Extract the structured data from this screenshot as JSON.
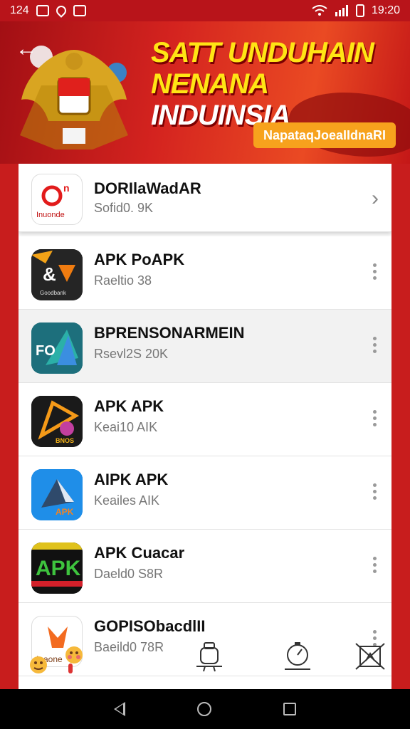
{
  "status_bar": {
    "left_text": "124",
    "time": "19:20"
  },
  "colors": {
    "primary": "#c81d1d",
    "accent": "#ffe514",
    "pill": "#f7a21d"
  },
  "header": {
    "title_line1": "SATT UNDUHAIN",
    "title_line2_a": "NENANA",
    "title_line2_b": "INDUINSIA",
    "pill_label": "NapataqJoeaIIdnaRI",
    "back_icon": "back-arrow-icon"
  },
  "featured": {
    "name": "DORIlaWadAR",
    "sub": "Sofid0. 9K",
    "icon_text": "Inuonde"
  },
  "apps": [
    {
      "name": "APK PoAPK",
      "sub": "Raeltio 38",
      "icon_text": "Goodbank"
    },
    {
      "name": "BPRENSONARMEIN",
      "sub": "Rsevl2S 20K",
      "icon_text": "FO"
    },
    {
      "name": "APK APK",
      "sub": "Keai10 AIK",
      "icon_text": "BNOS"
    },
    {
      "name": "AIPK APK",
      "sub": "Keailes AIK",
      "icon_text": "APK"
    },
    {
      "name": "APK Cuacar",
      "sub": "Daeld0 S8R",
      "icon_text": "APK"
    },
    {
      "name": "GOPISObacdlII",
      "sub": "Baeild0 78R",
      "icon_text": "Inaone"
    }
  ],
  "nav": {
    "back": "nav-back-icon",
    "home": "nav-home-icon",
    "recent": "nav-recent-icon"
  }
}
